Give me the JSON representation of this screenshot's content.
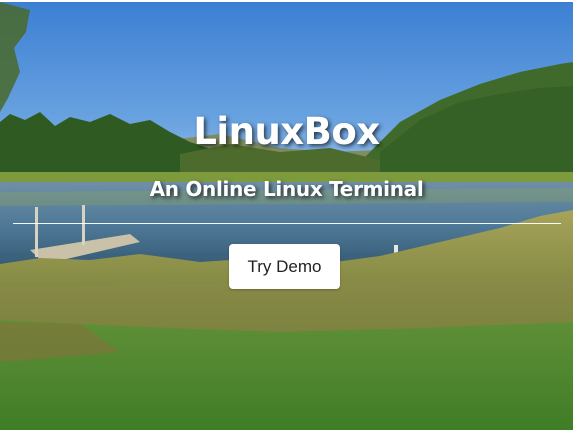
{
  "hero": {
    "title": "LinuxBox",
    "subtitle": "An Online Linux Terminal",
    "cta_label": "Try Demo"
  },
  "colors": {
    "title_text": "#ffffff",
    "button_bg": "#ffffff",
    "button_text": "#222222",
    "sky": "#4f8ed6",
    "grass": "#4e8a2e"
  }
}
